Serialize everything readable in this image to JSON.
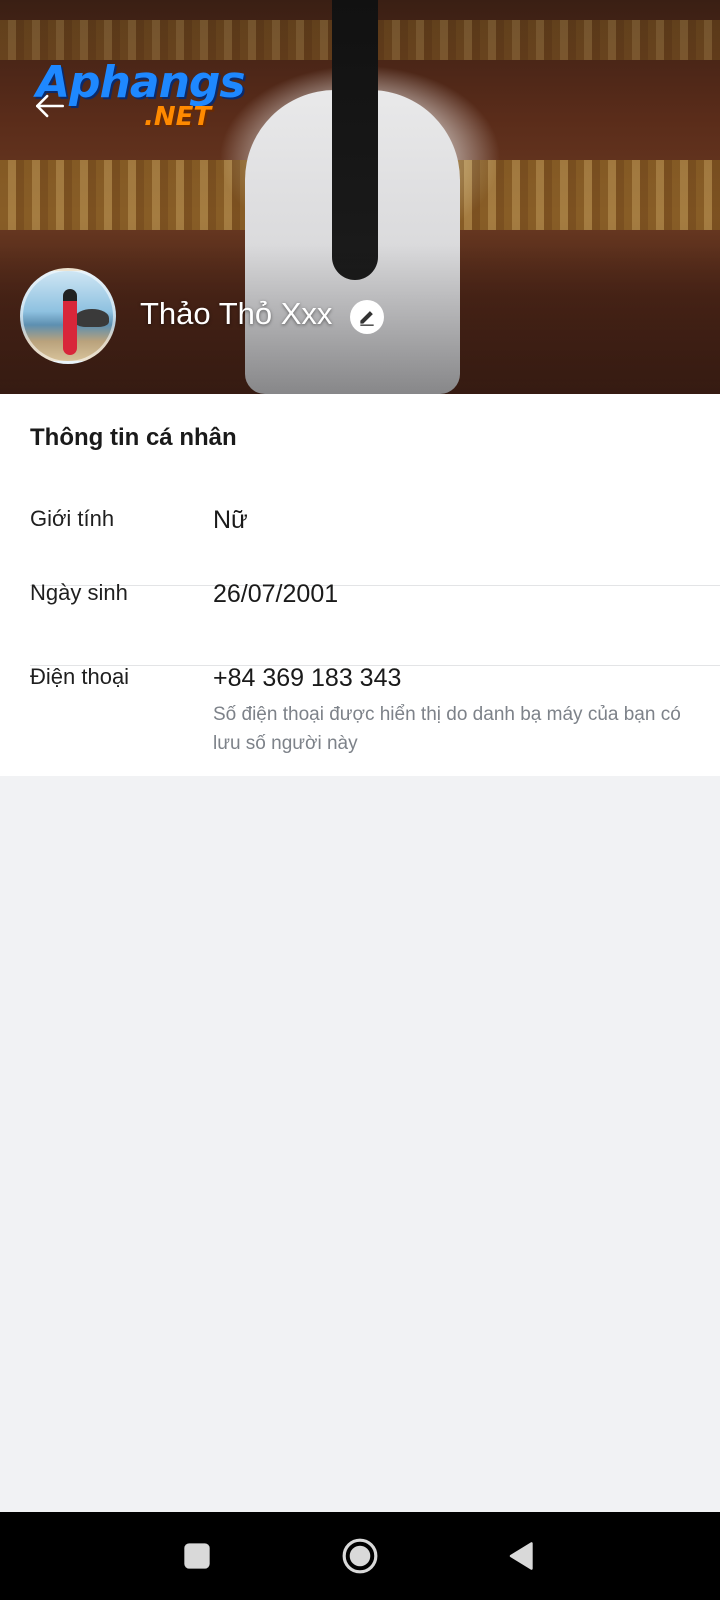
{
  "header": {
    "back_icon": "arrow-left-icon",
    "watermark": {
      "main": "Aphangs",
      "sub": ".NET"
    },
    "profile_name": "Thảo Thỏ Xxx",
    "edit_icon": "pencil-icon"
  },
  "personal_info": {
    "title": "Thông tin cá nhân",
    "rows": [
      {
        "label": "Giới tính",
        "value": "Nữ"
      },
      {
        "label": "Ngày sinh",
        "value": "26/07/2001"
      },
      {
        "label": "Điện thoại",
        "value": "+84 369 183 343",
        "note": "Số điện thoại được hiển thị do danh bạ máy của bạn có lưu số người này"
      }
    ]
  },
  "navbar": {
    "buttons": [
      "recent-apps-icon",
      "home-icon",
      "back-triangle-icon"
    ]
  },
  "colors": {
    "background": "#f1f2f4",
    "card": "#ffffff",
    "note_text": "#7d8289",
    "navbar": "#000000"
  }
}
